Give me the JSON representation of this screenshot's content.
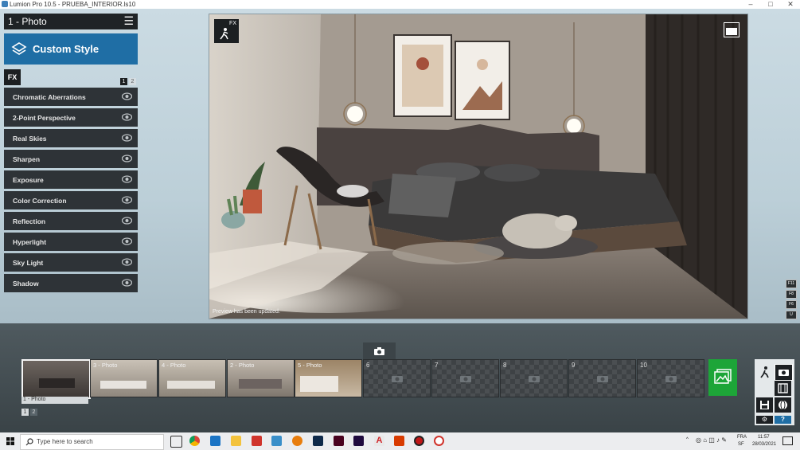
{
  "window": {
    "title": "Lumion Pro 10.5  -  PRUEBA_INTERIOR.ls10",
    "minimize": "–",
    "maximize": "□",
    "close": "✕"
  },
  "left_panel": {
    "photo_selector": "1 - Photo",
    "menu_icon": "hamburger-icon",
    "style_button": "Custom Style",
    "fx_tab": "FX",
    "pages": [
      "1",
      "2"
    ],
    "effects": [
      "Chromatic Aberrations",
      "2-Point Perspective",
      "Real Skies",
      "Sharpen",
      "Exposure",
      "Color Correction",
      "Reflection",
      "Hyperlight",
      "Sky Light",
      "Shadow"
    ]
  },
  "viewport": {
    "fx_badge": "FX",
    "status": "Preview has been updated.",
    "function_keys": [
      "F11",
      "F8",
      "F6",
      "U"
    ]
  },
  "photo_strip": {
    "slots": [
      {
        "label": "",
        "filled": true
      },
      {
        "label": "3 - Photo",
        "filled": true
      },
      {
        "label": "4 - Photo",
        "filled": true
      },
      {
        "label": "2 - Photo",
        "filled": true
      },
      {
        "label": "5 - Photo",
        "filled": true
      },
      {
        "label": "6",
        "filled": false
      },
      {
        "label": "7",
        "filled": false
      },
      {
        "label": "8",
        "filled": false
      },
      {
        "label": "9",
        "filled": false
      },
      {
        "label": "10",
        "filled": false
      }
    ],
    "selected_label": "1 - Photo",
    "pages": [
      "1",
      "2"
    ]
  },
  "mode_panel": {
    "help": "?"
  },
  "taskbar": {
    "search_placeholder": "Type here to search",
    "lang_top": "FRA",
    "lang_bottom": "SF",
    "time": "11:57",
    "date": "28/03/2021"
  },
  "colors": {
    "accent": "#1f6ea5",
    "render": "#1da538",
    "panel": "#2e3337"
  }
}
